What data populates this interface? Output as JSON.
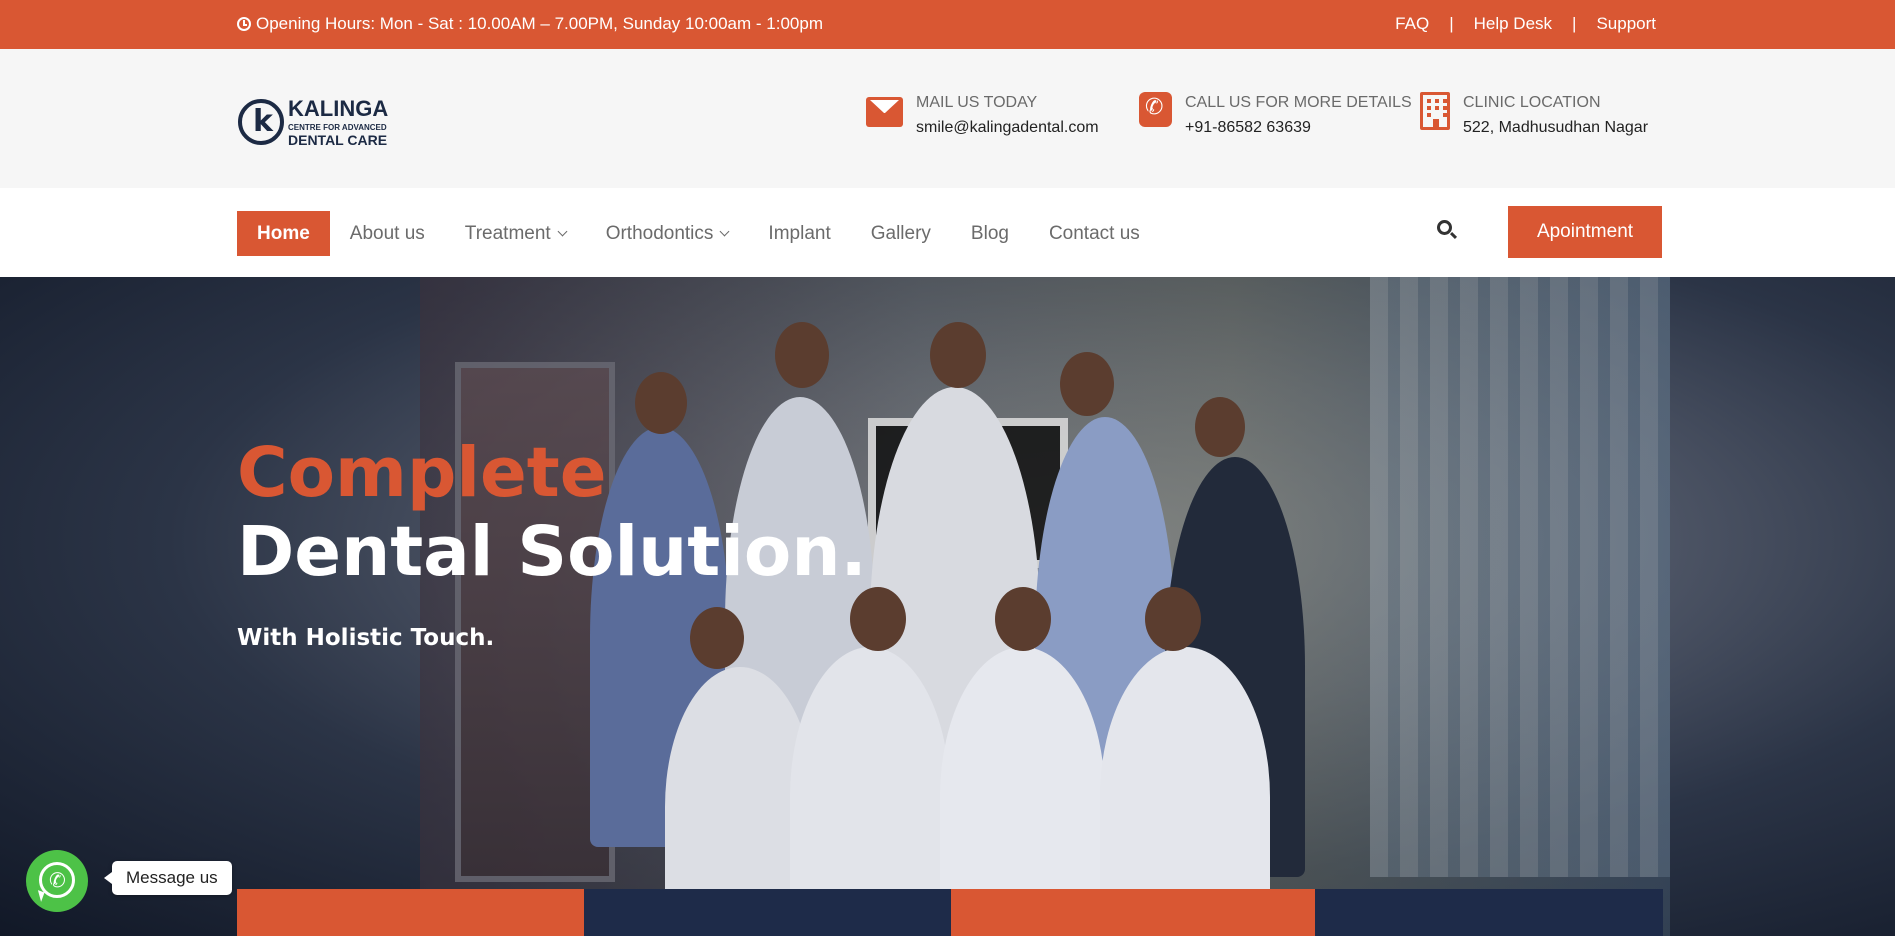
{
  "topbar": {
    "hours": "Opening Hours: Mon - Sat : 10.00AM – 7.00PM, Sunday 10:00am - 1:00pm",
    "links": [
      "FAQ",
      "Help Desk",
      "Support"
    ],
    "separator": "|"
  },
  "logo": {
    "line1": "KALINGA",
    "line2": "CENTRE FOR ADVANCED",
    "line3": "DENTAL CARE",
    "mark": "k"
  },
  "contact": {
    "mail": {
      "label": "MAIL US TODAY",
      "value": "smile@kalingadental.com",
      "icon": "envelope-icon"
    },
    "call": {
      "label": "CALL US FOR MORE DETAILS",
      "value": "+91-86582 63639",
      "icon": "phone-icon"
    },
    "location": {
      "label": "CLINIC LOCATION",
      "value": "522, Madhusudhan Nagar",
      "icon": "building-icon"
    }
  },
  "nav": {
    "items": [
      {
        "label": "Home",
        "active": true
      },
      {
        "label": "About us"
      },
      {
        "label": "Treatment",
        "dropdown": true
      },
      {
        "label": "Orthodontics",
        "dropdown": true
      },
      {
        "label": "Implant"
      },
      {
        "label": "Gallery"
      },
      {
        "label": "Blog"
      },
      {
        "label": "Contact us"
      }
    ],
    "appointment": "Apointment"
  },
  "hero": {
    "title_accent": "Complete",
    "title_main": "Dental Solution.",
    "subtitle": "With Holistic Touch."
  },
  "whatsapp": {
    "label": "Message us"
  },
  "colors": {
    "accent": "#d95733",
    "navy": "#1e2b49",
    "whatsapp": "#4dc247"
  }
}
